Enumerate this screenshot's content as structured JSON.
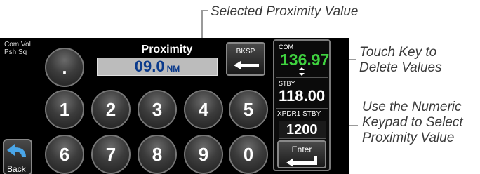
{
  "callouts": {
    "selected_proximity": "Selected Proximity Value",
    "delete_line1": "Touch Key to",
    "delete_line2": "Delete Values",
    "numeric_line1": "Use the Numeric",
    "numeric_line2": "Keypad to Select",
    "numeric_line3": "Proximity Value"
  },
  "left": {
    "com_vol_line1": "Com Vol",
    "com_vol_line2": "Psh Sq",
    "back_label": "Back"
  },
  "keypad": {
    "title": "Proximity",
    "value": "09.0",
    "unit": "NM",
    "decimal": ".",
    "keys": [
      "1",
      "2",
      "3",
      "4",
      "5",
      "6",
      "7",
      "8",
      "9",
      "0"
    ],
    "bksp_label": "BKSP"
  },
  "com": {
    "label": "COM",
    "active": "136.97",
    "stby_label": "STBY",
    "stby": "118.00",
    "xpdr_label": "XPDR1 STBY",
    "squawk": "1200",
    "enter_label": "Enter"
  },
  "colors": {
    "active_freq": "#3fd23f",
    "value_text": "#0a3a8c"
  }
}
